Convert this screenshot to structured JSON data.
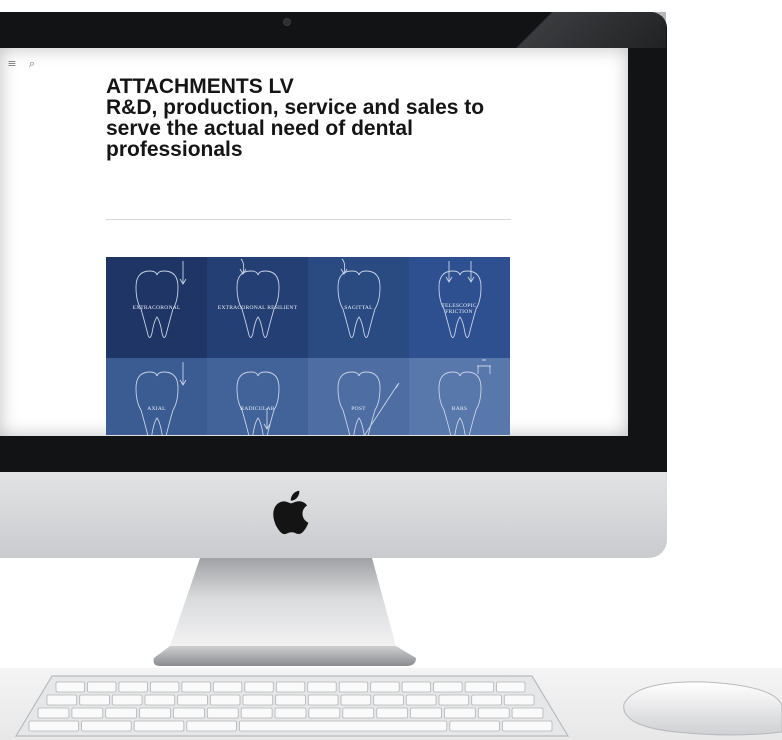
{
  "website": {
    "toolbar_icons": [
      {
        "name": "menu-icon",
        "glyph": "≡"
      },
      {
        "name": "search-icon",
        "glyph": "⌕"
      }
    ],
    "heading_line1": "ATTACHMENTS LV",
    "heading_line2": "R&D, production, service and sales to serve the actual need of dental professionals",
    "categories": [
      {
        "label": "EXTRACORONAL",
        "color": "#1e3566",
        "icon": "tooth-arrow-down-icon"
      },
      {
        "label": "EXTRACORONAL RESILIENT",
        "color": "#243f73",
        "icon": "tooth-curved-arrow-icon"
      },
      {
        "label": "SAGITTAL",
        "color": "#2a4a82",
        "icon": "tooth-curved-arrow-icon"
      },
      {
        "label": "TELESCOPIC FRICTION",
        "color": "#2e5090",
        "icon": "tooth-double-arrow-icon"
      },
      {
        "label": "AXIAL",
        "color": "#3a5c93",
        "icon": "tooth-arrow-down-icon"
      },
      {
        "label": "RADICULAR",
        "color": "#41639a",
        "icon": "tooth-arrow-inside-icon"
      },
      {
        "label": "POST",
        "color": "#4d6da3",
        "icon": "tooth-post-icon"
      },
      {
        "label": "BARS",
        "color": "#5877ab",
        "icon": "tooth-bar-icon"
      }
    ]
  },
  "device": {
    "bezel_color": "#121314",
    "chin_color": "#d6d7d9"
  }
}
